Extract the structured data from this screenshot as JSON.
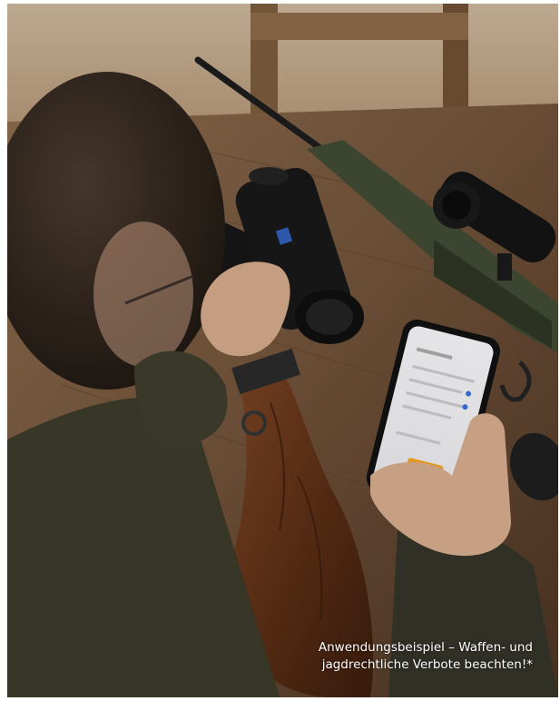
{
  "photo": {
    "icon": "hunter-thermal-monocular-photo"
  },
  "caption": {
    "line1": "Anwendungsbeispiel – Waffen- und",
    "line2": "jagdrechtliche Verbote beachten!*"
  }
}
